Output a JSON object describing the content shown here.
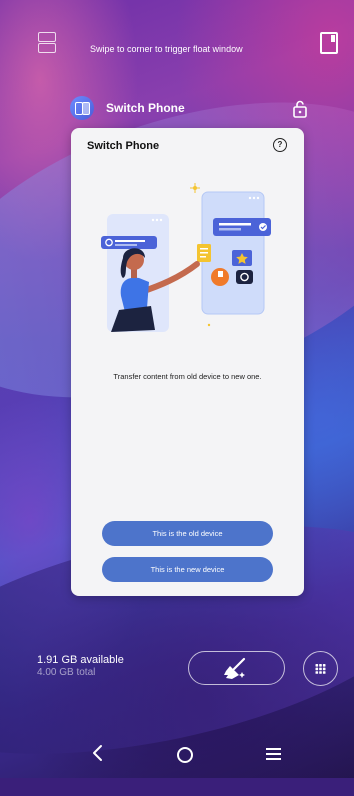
{
  "top_bar": {
    "hint_text": "Swipe to corner to trigger float window"
  },
  "app": {
    "name": "Switch Phone"
  },
  "card": {
    "title": "Switch Phone",
    "description": "Transfer content from old device to new one.",
    "old_device_button": "This is the old device",
    "new_device_button": "This is the new device"
  },
  "memory": {
    "available": "1.91 GB available",
    "total": "4.00 GB total"
  },
  "icons": {
    "top_left": "split-screen-icon",
    "top_right": "float-window-icon",
    "app": "switch-phone-app-icon",
    "lock": "unlock-icon",
    "help": "help-icon",
    "clean": "broom-clean-icon",
    "apps": "app-grid-icon",
    "back": "back-icon",
    "home": "home-icon",
    "recents": "recents-icon"
  },
  "colors": {
    "primary_button": "#4d74cb",
    "card_bg": "#f4f4f6"
  }
}
